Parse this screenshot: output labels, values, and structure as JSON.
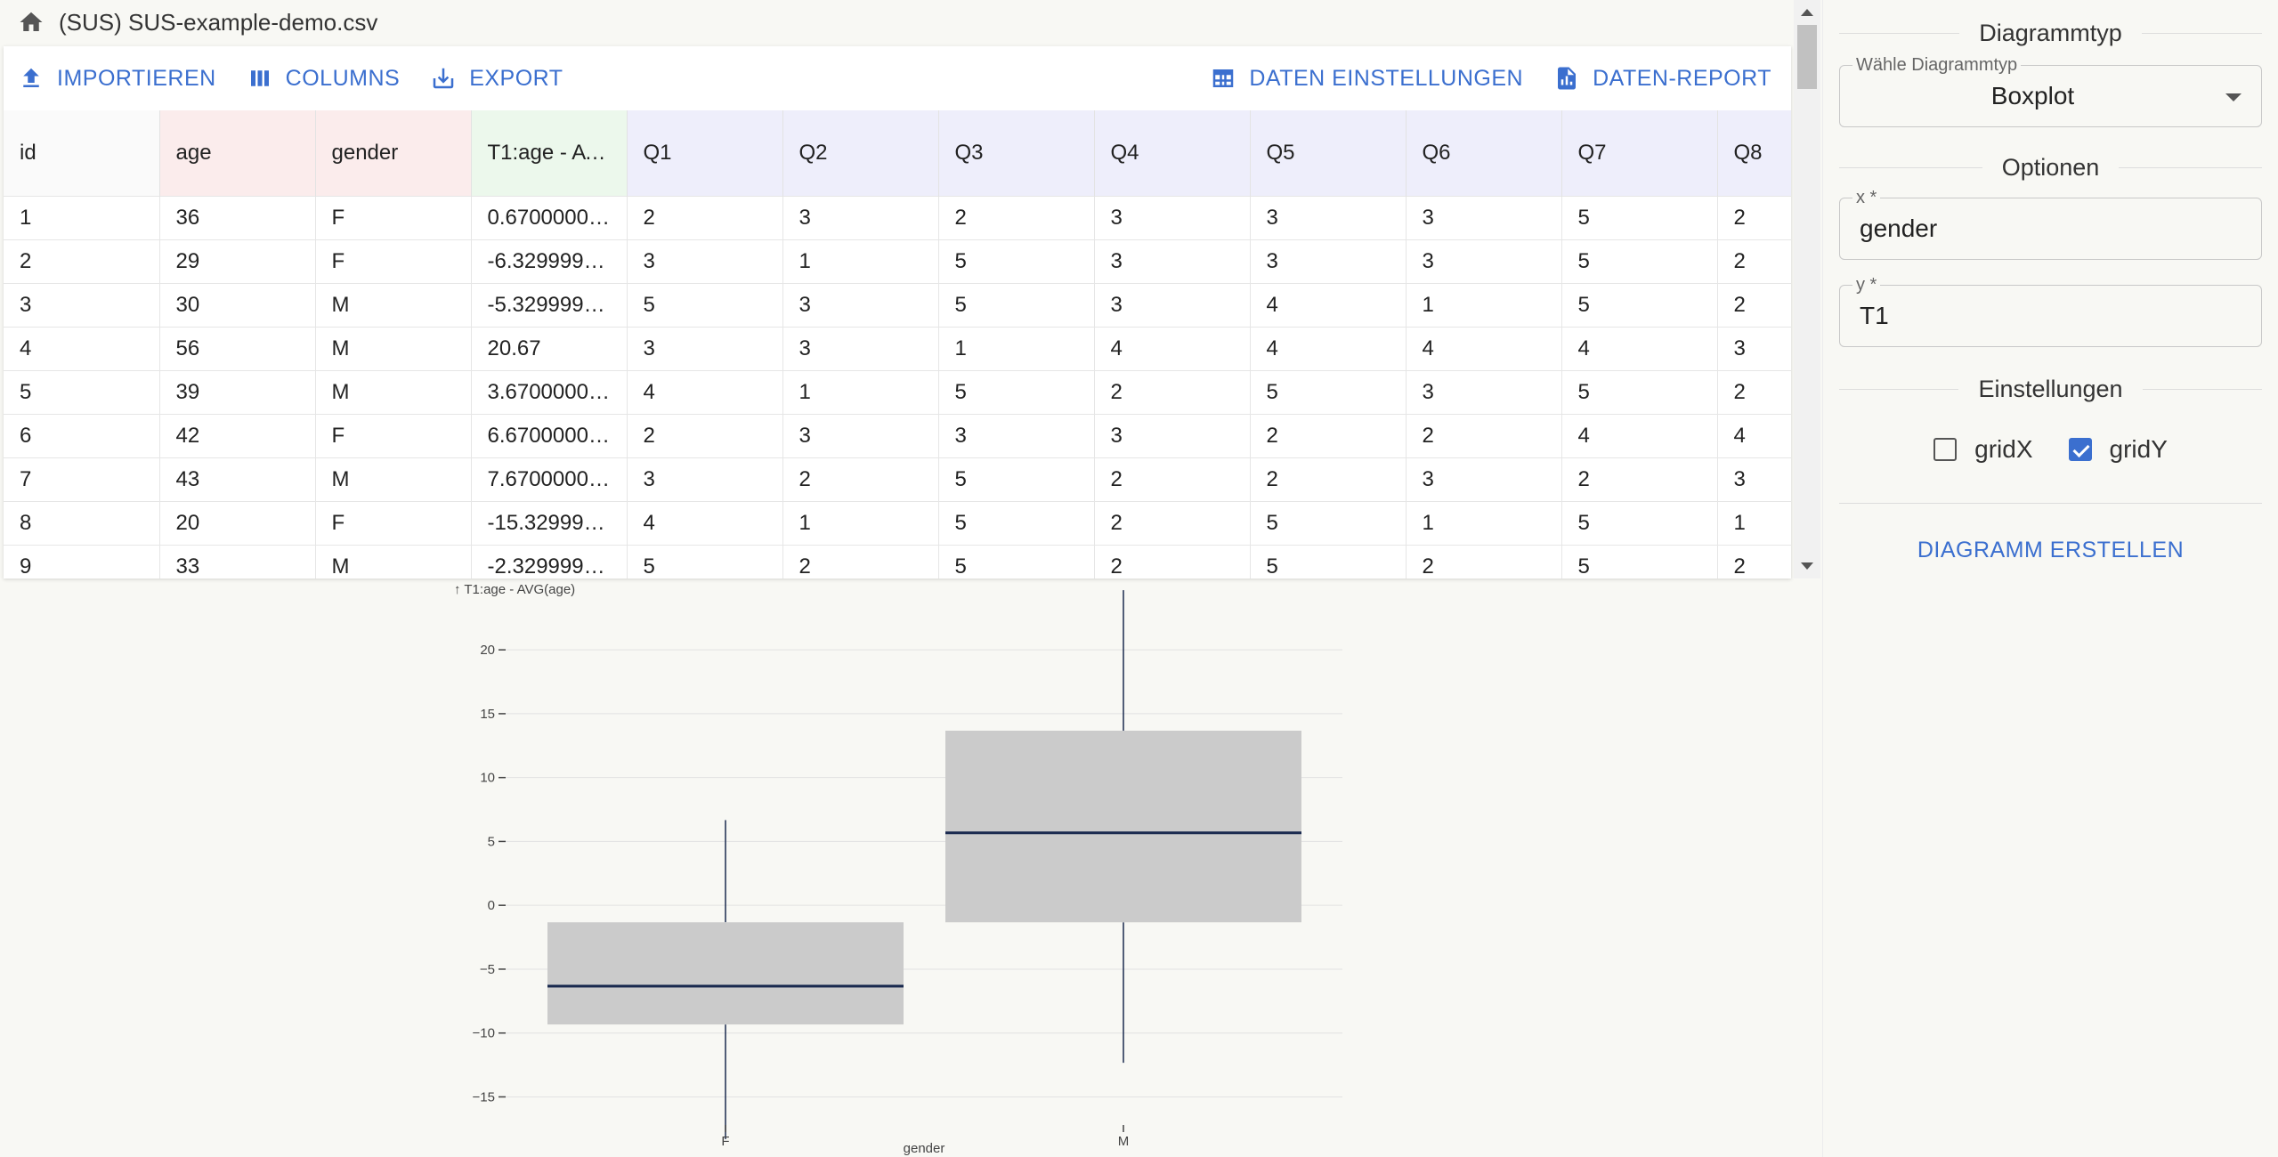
{
  "file": {
    "title": "(SUS) SUS-example-demo.csv",
    "home_icon": "home-icon"
  },
  "toolbar": {
    "import_label": "IMPORTIEREN",
    "columns_label": "COLUMNS",
    "export_label": "EXPORT",
    "settings_label": "DATEN EINSTELLUNGEN",
    "report_label": "DATEN-REPORT"
  },
  "table": {
    "columns": [
      "id",
      "age",
      "gender",
      "T1:age - AVG(age)",
      "Q1",
      "Q2",
      "Q3",
      "Q4",
      "Q5",
      "Q6",
      "Q7",
      "Q8"
    ],
    "rows": [
      [
        "1",
        "36",
        "F",
        "0.670000000000002",
        "2",
        "3",
        "2",
        "3",
        "3",
        "3",
        "5",
        "2"
      ],
      [
        "2",
        "29",
        "F",
        "-6.329999999999998",
        "3",
        "1",
        "5",
        "3",
        "3",
        "3",
        "5",
        "2"
      ],
      [
        "3",
        "30",
        "M",
        "-5.329999999999998",
        "5",
        "3",
        "5",
        "3",
        "4",
        "1",
        "5",
        "2"
      ],
      [
        "4",
        "56",
        "M",
        "20.67",
        "3",
        "3",
        "1",
        "4",
        "4",
        "4",
        "4",
        "3"
      ],
      [
        "5",
        "39",
        "M",
        "3.670000000000002",
        "4",
        "1",
        "5",
        "2",
        "5",
        "3",
        "5",
        "2"
      ],
      [
        "6",
        "42",
        "F",
        "6.670000000000002",
        "2",
        "3",
        "3",
        "3",
        "2",
        "2",
        "4",
        "4"
      ],
      [
        "7",
        "43",
        "M",
        "7.670000000000002",
        "3",
        "2",
        "5",
        "2",
        "2",
        "3",
        "2",
        "3"
      ],
      [
        "8",
        "20",
        "F",
        "-15.329999999999998",
        "4",
        "1",
        "5",
        "2",
        "5",
        "1",
        "5",
        "1"
      ],
      [
        "9",
        "33",
        "M",
        "-2.329999999999998",
        "5",
        "2",
        "5",
        "2",
        "5",
        "2",
        "5",
        "2"
      ]
    ]
  },
  "panel": {
    "chart_type_title": "Diagrammtyp",
    "chart_type_label": "Wähle Diagrammtyp",
    "chart_type_value": "Boxplot",
    "options_title": "Optionen",
    "x_label": "x *",
    "x_value": "gender",
    "y_label": "y *",
    "y_value": "T1",
    "settings_title": "Einstellungen",
    "gridx_label": "gridX",
    "gridx_checked": false,
    "gridy_label": "gridY",
    "gridy_checked": true,
    "create_label": "DIAGRAMM ERSTELLEN"
  },
  "colors": {
    "accent": "#3b6fcf",
    "box_fill": "#cbcbcb",
    "median": "#1a2a4f"
  },
  "chart_data": {
    "type": "boxplot",
    "ylabel": "↑ T1:age - AVG(age)",
    "xlabel": "gender",
    "categories": [
      "F",
      "M"
    ],
    "yticks": [
      20,
      15,
      10,
      5,
      0,
      -5,
      -10,
      -15
    ],
    "ytick_labels": [
      "20",
      "15",
      "10",
      "5",
      "0",
      "−5",
      "−10",
      "−15"
    ],
    "ylim": [
      -18.8,
      24.4
    ],
    "grid": {
      "x": false,
      "y": true
    },
    "boxes": [
      {
        "category": "F",
        "min": -18.3,
        "q1": -9.33,
        "median": -6.33,
        "q3": -1.33,
        "max": 6.67
      },
      {
        "category": "M",
        "min": -12.33,
        "q1": -1.33,
        "median": 5.67,
        "q3": 13.67,
        "max": 24.67
      }
    ]
  }
}
